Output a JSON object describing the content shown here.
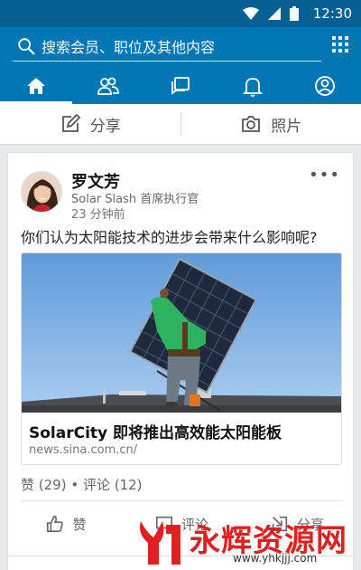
{
  "status_bar": {
    "time": "12:30"
  },
  "search": {
    "placeholder": "搜索会员、职位及其他内容"
  },
  "nav_tabs": [
    "home-icon",
    "network-icon",
    "messages-icon",
    "notifications-icon",
    "profile-icon"
  ],
  "share_bar": {
    "share_label": "分享",
    "photo_label": "照片"
  },
  "post": {
    "author": "罗文芳",
    "headline": "Solar Slash 首席执行官",
    "time": "23 分钟前",
    "text": "你们认为太阳能技术的进步会带来什么影响呢?",
    "link": {
      "title": "SolarCity 即将推出高效能太阳能板",
      "domain": "news.sina.com.cn/"
    },
    "stats": "赞 (29) • 评论 (12)",
    "actions": {
      "like": "赞",
      "comment": "评论",
      "share": "分享"
    }
  },
  "watermark": {
    "text": "永辉资源网",
    "url": "www.yhkjjj.com"
  },
  "colors": {
    "header_blue": "#0077b5",
    "status_blue": "#045f93",
    "background": "#e6e9ec"
  }
}
